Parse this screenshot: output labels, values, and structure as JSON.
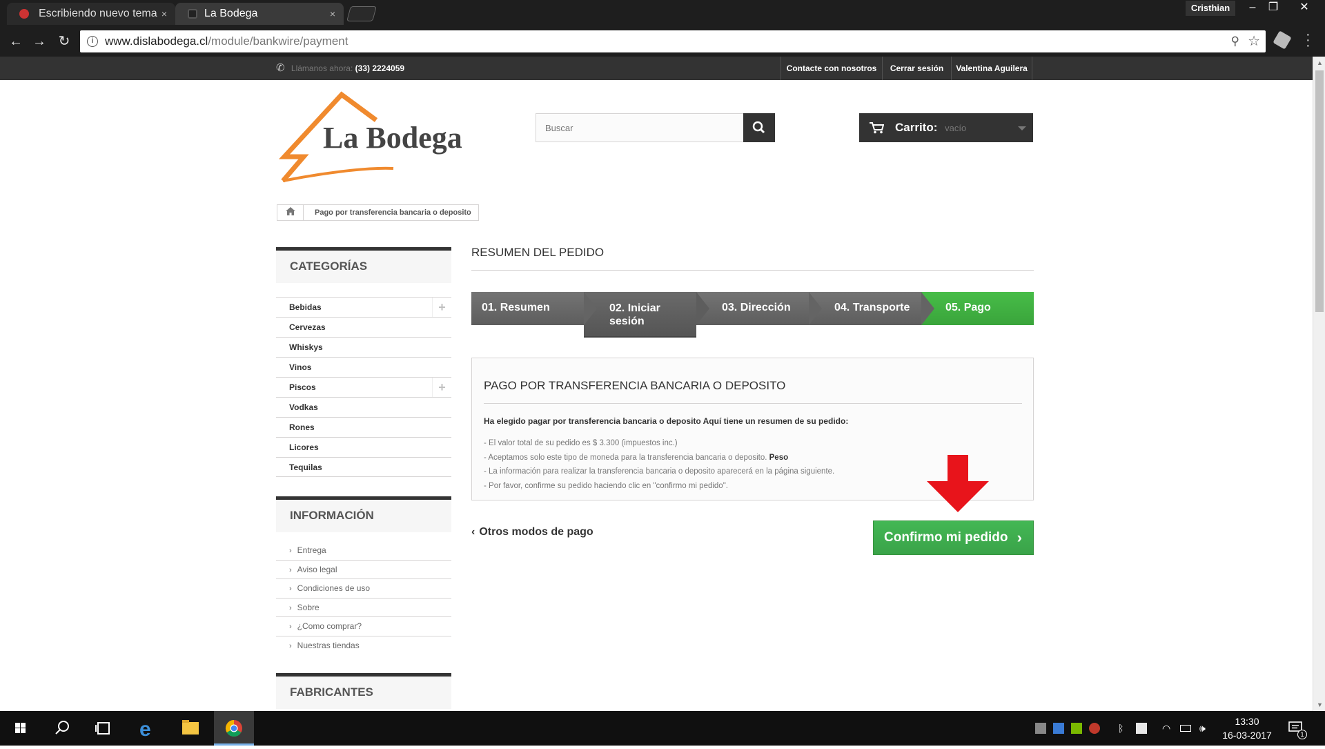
{
  "browser": {
    "tabs": [
      {
        "title": "Escribiendo nuevo tema",
        "close": "×"
      },
      {
        "title": "La Bodega",
        "close": "×"
      }
    ],
    "user": "Cristhian",
    "url_domain": "www.dislabodega.cl",
    "url_path": "/module/bankwire/payment",
    "window_controls": {
      "minimize": "–",
      "restore": "❐",
      "close": "✕"
    }
  },
  "topbar": {
    "call_label": "Llámanos ahora:",
    "phone": "(33) 2224059",
    "links": [
      "Contacte con nosotros",
      "Cerrar sesión",
      "Valentina Aguilera"
    ]
  },
  "header": {
    "logo_text": "La Bodega",
    "search_placeholder": "Buscar",
    "cart_label": "Carrito:",
    "cart_state": "vacío"
  },
  "breadcrumb": {
    "current": "Pago por transferencia bancaria o deposito"
  },
  "sidebar": {
    "categories_title": "CATEGORÍAS",
    "categories": [
      {
        "label": "Bebidas",
        "expandable": true
      },
      {
        "label": "Cervezas",
        "expandable": false
      },
      {
        "label": "Whiskys",
        "expandable": false
      },
      {
        "label": "Vinos",
        "expandable": false
      },
      {
        "label": "Piscos",
        "expandable": true
      },
      {
        "label": "Vodkas",
        "expandable": false
      },
      {
        "label": "Rones",
        "expandable": false
      },
      {
        "label": "Licores",
        "expandable": false
      },
      {
        "label": "Tequilas",
        "expandable": false
      }
    ],
    "info_title": "INFORMACIÓN",
    "info": [
      "Entrega",
      "Aviso legal",
      "Condiciones de uso",
      "Sobre",
      "¿Como comprar?",
      "Nuestras tiendas"
    ],
    "brands_title": "FABRICANTES"
  },
  "main": {
    "heading": "RESUMEN DEL PEDIDO",
    "steps": [
      {
        "label": "01. Resumen"
      },
      {
        "label_1": "02. Iniciar",
        "label_2": "sesión"
      },
      {
        "label": "03. Dirección"
      },
      {
        "label": "04. Transporte"
      },
      {
        "label": "05. Pago"
      }
    ],
    "payment": {
      "title": "PAGO POR TRANSFERENCIA BANCARIA O DEPOSITO",
      "lead": "Ha elegido pagar por transferencia bancaria o deposito Aquí tiene un resumen de su pedido:",
      "line1": "- El valor total de su pedido es $ 3.300 (impuestos inc.)",
      "line2": "- Aceptamos solo este tipo de moneda para la transferencia bancaria o deposito.",
      "line2_currency": "Peso",
      "line3": "- La información para realizar la transferencia bancaria o deposito aparecerá en la página siguiente.",
      "line4": "- Por favor, confirme su pedido haciendo clic en \"confirmo mi pedido\"."
    },
    "back_link": "Otros modos de pago",
    "confirm_button": "Confirmo mi pedido"
  },
  "taskbar": {
    "time": "13:30",
    "date": "16-03-2017",
    "notification_count": "1"
  }
}
